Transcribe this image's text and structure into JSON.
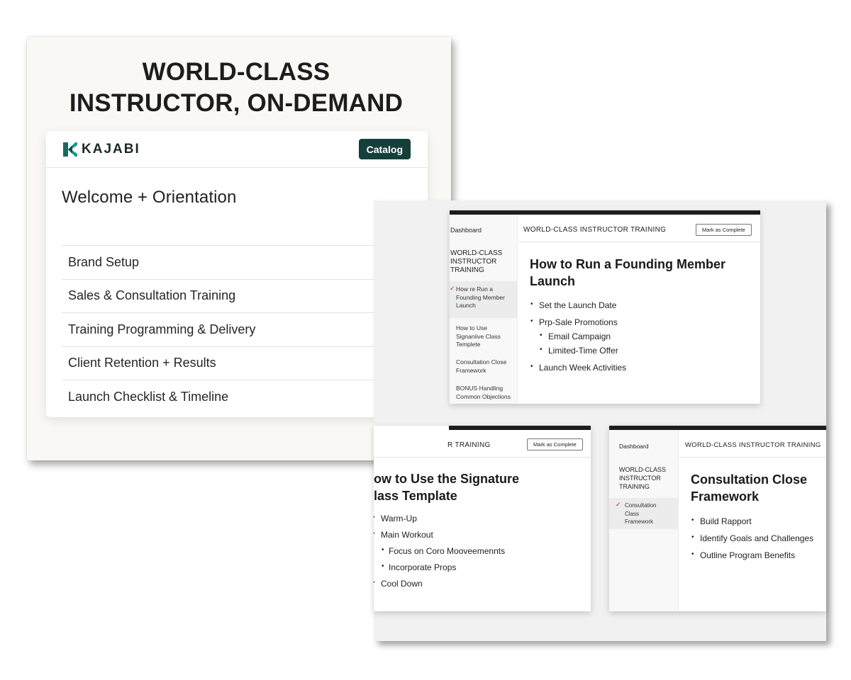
{
  "hero": {
    "title_line1": "WORLD-CLASS",
    "title_line2": "INSTRUCTOR, ON-DEMAND"
  },
  "portal": {
    "logo_text": "KAJABI",
    "catalog_label": "Catalog",
    "heading": "Welcome + Orientation",
    "modules": [
      "Brand Setup",
      "Sales & Consultation Training",
      "Training Programming & Delivery",
      "Client Retention + Results",
      "Launch Checklist & Timeline"
    ],
    "brand_color": "#163f3c"
  },
  "lesson_1": {
    "dashboard": "Dashboard",
    "sidebar_course": "WORLD-CLASS INSTRUCTOR TRAINING",
    "sidebar_items": [
      "How re Run a Founding Member Launch",
      "How to Use Signaniive Class Templete",
      "Consultation Close Framework",
      "BONUS Handling Common Objections"
    ],
    "course_title": "WORLD-CLASS INSTRUCTOR TRAINING",
    "mark_label": "Mark as Complete",
    "title": "How to Run a Founding Member Launch",
    "bullets": [
      "Set the Launch Date",
      "Prp-Sale Promotions",
      "Email Campaign",
      "Limited-Time Offer",
      "Launch Week Activities"
    ]
  },
  "lesson_2": {
    "course_title": "R TRAINING",
    "mark_label": "Mark as Complete",
    "title_line1": "ow to Use the Signature",
    "title_line2": "lass Template",
    "bullets": [
      "Warm-Up",
      "Main Workout",
      "Focus on Coro Mooveemennts",
      "Incorporate Props",
      "Cool Down"
    ]
  },
  "lesson_3": {
    "dashboard": "Dashboard",
    "sidebar_course": "WORLD-CLASS INSTRUCTOR TRAINING",
    "sidebar_item": "Consultation Class Framework",
    "course_title": "WORLD-CLASS INSTRUCTOR TRAINING",
    "title": "Consultation Close Framework",
    "bullets": [
      "Build Rapport",
      "Identify Goals and Challenges",
      "Outline Program Benefits"
    ]
  }
}
